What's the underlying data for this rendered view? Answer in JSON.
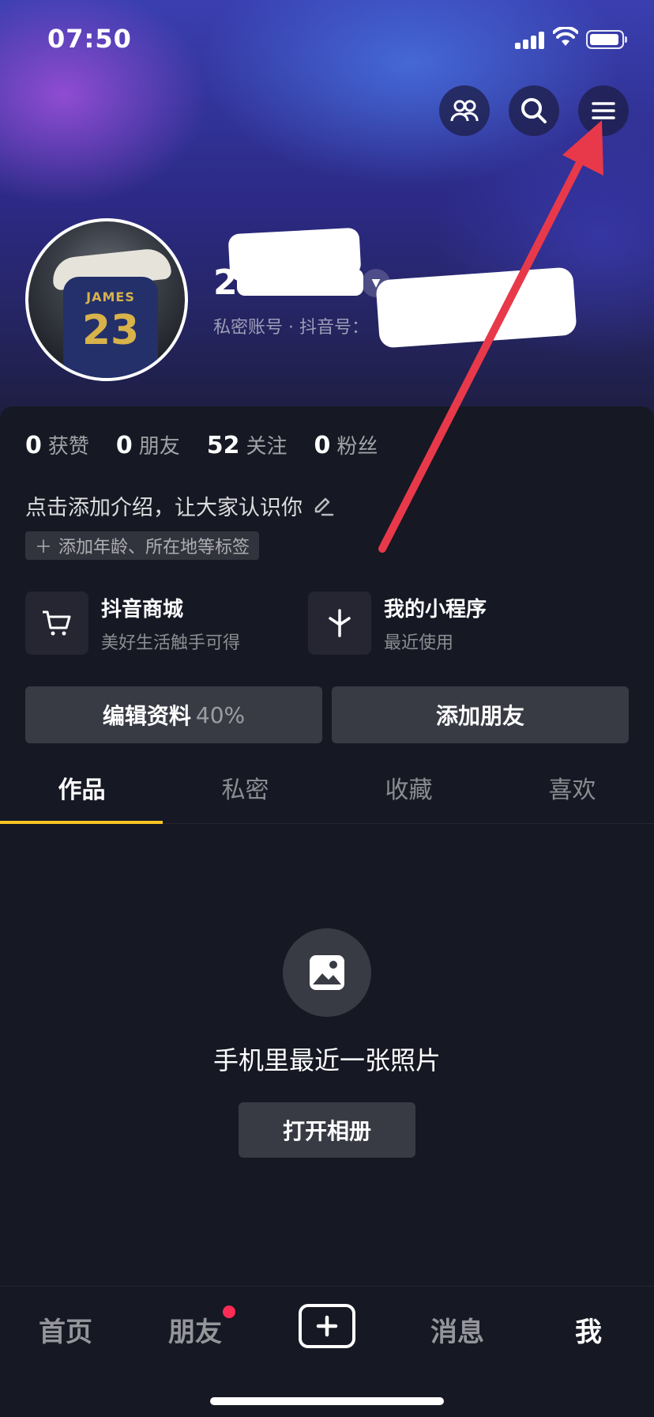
{
  "status_bar": {
    "time": "07:50"
  },
  "header": {
    "icons": [
      "friends-icon",
      "search-icon",
      "menu-icon"
    ]
  },
  "profile": {
    "display_name": "2",
    "account_line": "私密账号 · 抖音号："
  },
  "stats": [
    {
      "value": "0",
      "label": "获赞"
    },
    {
      "value": "0",
      "label": "朋友"
    },
    {
      "value": "52",
      "label": "关注"
    },
    {
      "value": "0",
      "label": "粉丝"
    }
  ],
  "bio": {
    "text": "点击添加介绍，让大家认识你",
    "tag_chip": "添加年龄、所在地等标签"
  },
  "features": {
    "shop_title": "抖音商城",
    "shop_sub": "美好生活触手可得",
    "mini_title": "我的小程序",
    "mini_sub": "最近使用"
  },
  "actions": {
    "edit_label": "编辑资料",
    "edit_progress": "40%",
    "add_friend_label": "添加朋友"
  },
  "tabs": [
    {
      "label": "作品",
      "active": true
    },
    {
      "label": "私密",
      "active": false
    },
    {
      "label": "收藏",
      "active": false
    },
    {
      "label": "喜欢",
      "active": false
    }
  ],
  "empty_state": {
    "title": "手机里最近一张照片",
    "button": "打开相册"
  },
  "bottom_nav": {
    "home": "首页",
    "friends": "朋友",
    "messages": "消息",
    "me": "我"
  },
  "colors": {
    "background": "#161823",
    "tab_indicator": "#f6c524",
    "notification_dot": "#fe2c55",
    "annotation_arrow": "#e8394a"
  },
  "avatar": {
    "jersey_name": "JAMES",
    "jersey_number": "23"
  }
}
